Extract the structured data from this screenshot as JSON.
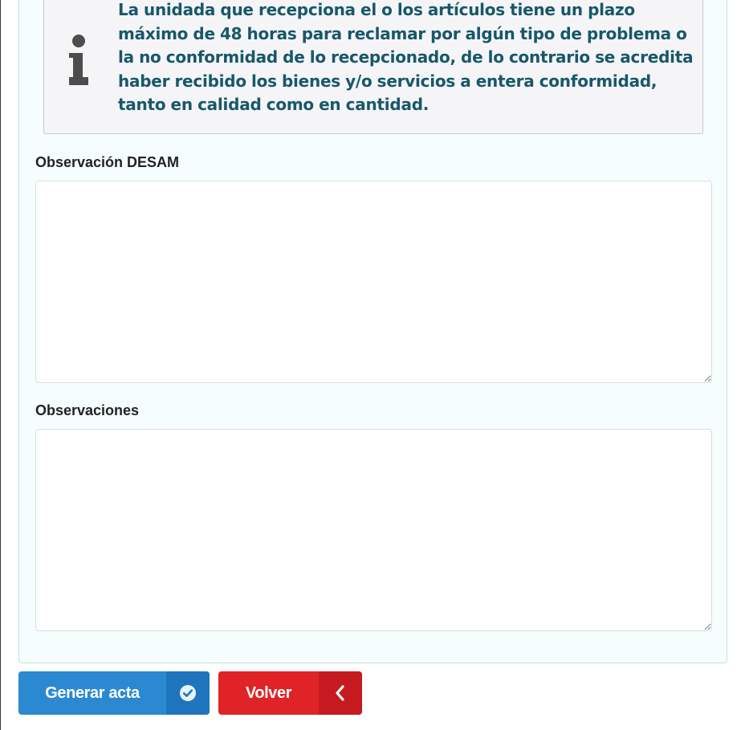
{
  "info": {
    "icon": "info-icon",
    "text": "La unidada que recepciona el o los artículos tiene un plazo máximo de 48 horas para reclamar por algún tipo de problema o la no conformidad de lo recepcionado, de lo contrario se acredita haber recibido los bienes y/o servicios a entera conformidad, tanto en calidad como en cantidad.",
    "text_color": "#175869"
  },
  "fields": {
    "observacion_desam": {
      "label": "Observación DESAM",
      "value": ""
    },
    "observaciones": {
      "label": "Observaciones",
      "value": ""
    }
  },
  "actions": {
    "generar": {
      "label": "Generar acta",
      "icon": "check-circle-icon",
      "color": "#2b89d1"
    },
    "volver": {
      "label": "Volver",
      "icon": "chevron-left-icon",
      "color": "#df2327"
    }
  }
}
